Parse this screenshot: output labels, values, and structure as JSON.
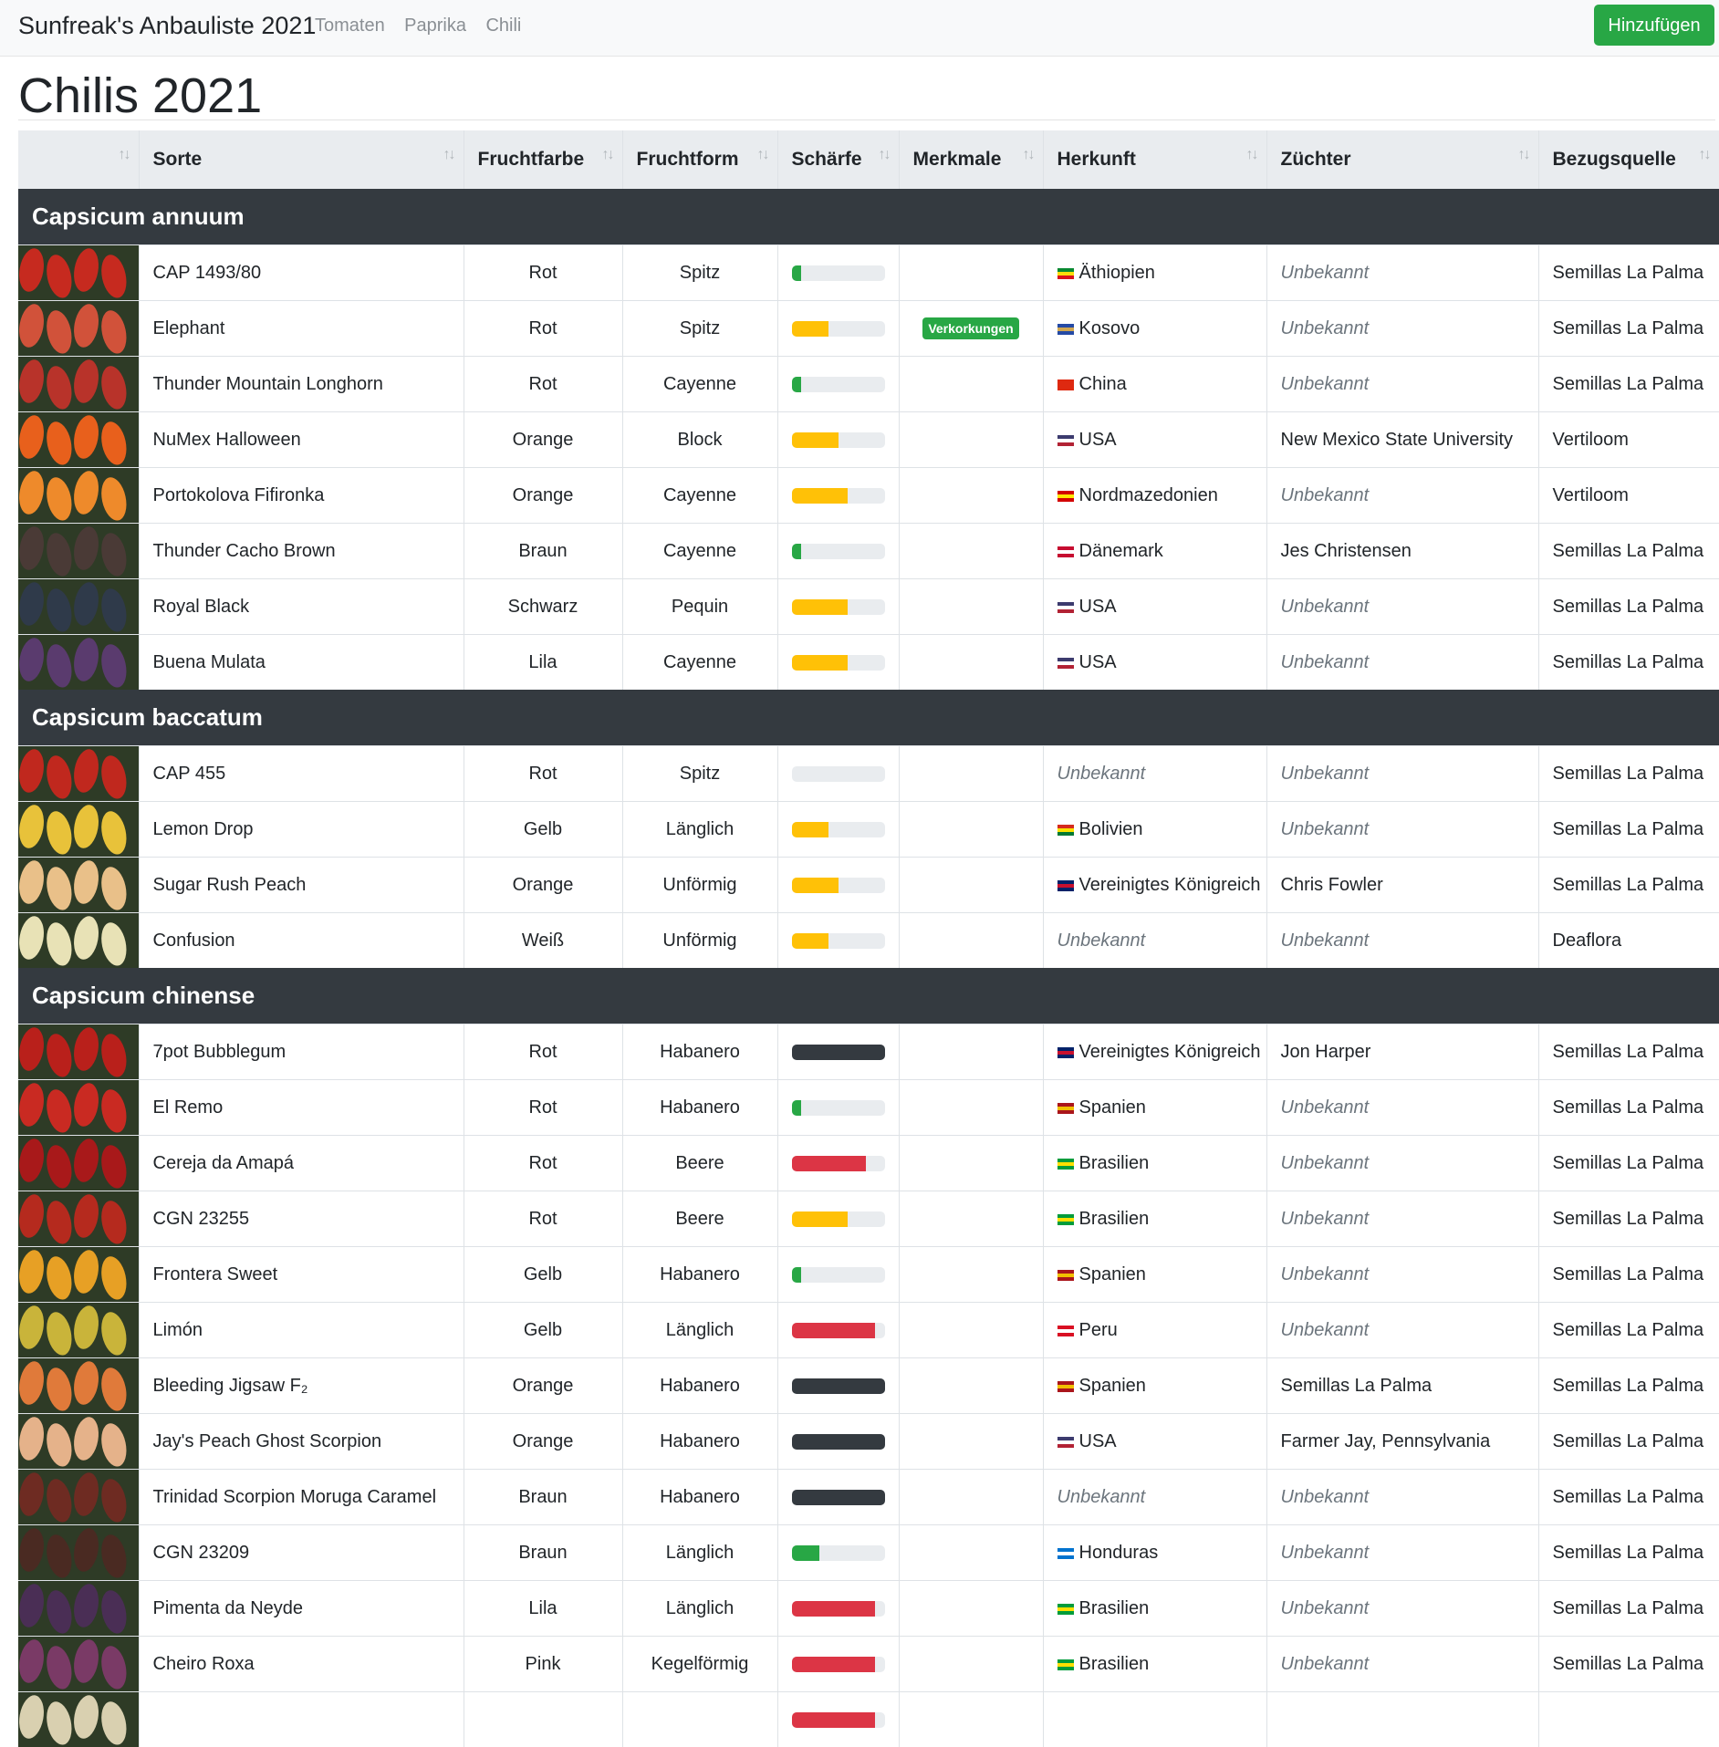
{
  "nav": {
    "brand": "Sunfreak's Anbauliste 2021",
    "links": [
      "Tomaten",
      "Paprika",
      "Chili"
    ],
    "add_label": "Hinzufügen"
  },
  "page_title": "Chilis 2021",
  "columns": [
    "Sorte",
    "Fruchtfarbe",
    "Fruchtform",
    "Schärfe",
    "Merkmale",
    "Herkunft",
    "Züchter",
    "Bezugsquelle"
  ],
  "sort_icon": "↑↓",
  "colors": {
    "mild": "#28a745",
    "medium": "#ffc107",
    "hot": "#dc3545",
    "extreme": "#343a40"
  },
  "groups": [
    {
      "name": "Capsicum annuum",
      "rows": [
        {
          "thumb": "#c62a1f",
          "name": "CAP 1493/80",
          "color": "Rot",
          "shape": "Spitz",
          "heat": 0.1,
          "heat_color": "#28a745",
          "feature": "",
          "origin": "Äthiopien",
          "origin_unknown": false,
          "flag": [
            "#078930",
            "#fcdd09",
            "#da121a"
          ],
          "breeder": "Unbekannt",
          "breeder_unknown": true,
          "source": "Semillas La Palma"
        },
        {
          "thumb": "#d1523a",
          "name": "Elephant",
          "color": "Rot",
          "shape": "Spitz",
          "heat": 0.4,
          "heat_color": "#ffc107",
          "feature": "Verkorkungen",
          "origin": "Kosovo",
          "origin_unknown": false,
          "flag": [
            "#244aa5",
            "#d0a650",
            "#244aa5"
          ],
          "breeder": "Unbekannt",
          "breeder_unknown": true,
          "source": "Semillas La Palma"
        },
        {
          "thumb": "#b8332a",
          "name": "Thunder Mountain Longhorn",
          "color": "Rot",
          "shape": "Cayenne",
          "heat": 0.1,
          "heat_color": "#28a745",
          "feature": "",
          "origin": "China",
          "origin_unknown": false,
          "flag": [
            "#de2910",
            "#de2910",
            "#de2910"
          ],
          "breeder": "Unbekannt",
          "breeder_unknown": true,
          "source": "Semillas La Palma"
        },
        {
          "thumb": "#e8601c",
          "name": "NuMex Halloween",
          "color": "Orange",
          "shape": "Block",
          "heat": 0.5,
          "heat_color": "#ffc107",
          "feature": "",
          "origin": "USA",
          "origin_unknown": false,
          "flag": [
            "#3c3b6e",
            "#ffffff",
            "#b22234"
          ],
          "breeder": "New Mexico State University",
          "breeder_unknown": false,
          "source": "Vertiloom"
        },
        {
          "thumb": "#ee8a2b",
          "name": "Portokolova Fifironka",
          "color": "Orange",
          "shape": "Cayenne",
          "heat": 0.6,
          "heat_color": "#ffc107",
          "feature": "",
          "origin": "Nordmazedonien",
          "origin_unknown": false,
          "flag": [
            "#d20000",
            "#ffe600",
            "#d20000"
          ],
          "breeder": "Unbekannt",
          "breeder_unknown": true,
          "source": "Vertiloom"
        },
        {
          "thumb": "#4a3a36",
          "name": "Thunder Cacho Brown",
          "color": "Braun",
          "shape": "Cayenne",
          "heat": 0.1,
          "heat_color": "#28a745",
          "feature": "",
          "origin": "Dänemark",
          "origin_unknown": false,
          "flag": [
            "#c60c30",
            "#ffffff",
            "#c60c30"
          ],
          "breeder": "Jes Christensen",
          "breeder_unknown": false,
          "source": "Semillas La Palma"
        },
        {
          "thumb": "#2f3a4a",
          "name": "Royal Black",
          "color": "Schwarz",
          "shape": "Pequin",
          "heat": 0.6,
          "heat_color": "#ffc107",
          "feature": "",
          "origin": "USA",
          "origin_unknown": false,
          "flag": [
            "#3c3b6e",
            "#ffffff",
            "#b22234"
          ],
          "breeder": "Unbekannt",
          "breeder_unknown": true,
          "source": "Semillas La Palma"
        },
        {
          "thumb": "#5a3b6e",
          "name": "Buena Mulata",
          "color": "Lila",
          "shape": "Cayenne",
          "heat": 0.6,
          "heat_color": "#ffc107",
          "feature": "",
          "origin": "USA",
          "origin_unknown": false,
          "flag": [
            "#3c3b6e",
            "#ffffff",
            "#b22234"
          ],
          "breeder": "Unbekannt",
          "breeder_unknown": true,
          "source": "Semillas La Palma"
        }
      ]
    },
    {
      "name": "Capsicum baccatum",
      "rows": [
        {
          "thumb": "#c0281e",
          "name": "CAP 455",
          "color": "Rot",
          "shape": "Spitz",
          "heat": 0,
          "heat_color": "#ffc107",
          "feature": "",
          "origin": "Unbekannt",
          "origin_unknown": true,
          "flag": null,
          "breeder": "Unbekannt",
          "breeder_unknown": true,
          "source": "Semillas La Palma"
        },
        {
          "thumb": "#e8c23a",
          "name": "Lemon Drop",
          "color": "Gelb",
          "shape": "Länglich",
          "heat": 0.4,
          "heat_color": "#ffc107",
          "feature": "",
          "origin": "Bolivien",
          "origin_unknown": false,
          "flag": [
            "#d52b1e",
            "#f9e300",
            "#007934"
          ],
          "breeder": "Unbekannt",
          "breeder_unknown": true,
          "source": "Semillas La Palma"
        },
        {
          "thumb": "#e9c089",
          "name": "Sugar Rush Peach",
          "color": "Orange",
          "shape": "Unförmig",
          "heat": 0.5,
          "heat_color": "#ffc107",
          "feature": "",
          "origin": "Vereinigtes Königreich",
          "origin_unknown": false,
          "flag": [
            "#012169",
            "#c8102e",
            "#012169"
          ],
          "breeder": "Chris Fowler",
          "breeder_unknown": false,
          "source": "Semillas La Palma"
        },
        {
          "thumb": "#e8e2b6",
          "name": "Confusion",
          "color": "Weiß",
          "shape": "Unförmig",
          "heat": 0.4,
          "heat_color": "#ffc107",
          "feature": "",
          "origin": "Unbekannt",
          "origin_unknown": true,
          "flag": null,
          "breeder": "Unbekannt",
          "breeder_unknown": true,
          "source": "Deaflora"
        }
      ]
    },
    {
      "name": "Capsicum chinense",
      "rows": [
        {
          "thumb": "#b9201b",
          "name": "7pot Bubblegum",
          "color": "Rot",
          "shape": "Habanero",
          "heat": 1.0,
          "heat_color": "#343a40",
          "feature": "",
          "origin": "Vereinigtes Königreich",
          "origin_unknown": false,
          "flag": [
            "#012169",
            "#c8102e",
            "#012169"
          ],
          "breeder": "Jon Harper",
          "breeder_unknown": false,
          "source": "Semillas La Palma"
        },
        {
          "thumb": "#c92a22",
          "name": "El Remo",
          "color": "Rot",
          "shape": "Habanero",
          "heat": 0.1,
          "heat_color": "#28a745",
          "feature": "",
          "origin": "Spanien",
          "origin_unknown": false,
          "flag": [
            "#aa151b",
            "#f1bf00",
            "#aa151b"
          ],
          "breeder": "Unbekannt",
          "breeder_unknown": true,
          "source": "Semillas La Palma"
        },
        {
          "thumb": "#a8191a",
          "name": "Cereja da Amapá",
          "color": "Rot",
          "shape": "Beere",
          "heat": 0.8,
          "heat_color": "#dc3545",
          "feature": "",
          "origin": "Brasilien",
          "origin_unknown": false,
          "flag": [
            "#009c3b",
            "#ffdf00",
            "#009c3b"
          ],
          "breeder": "Unbekannt",
          "breeder_unknown": true,
          "source": "Semillas La Palma"
        },
        {
          "thumb": "#b52a1e",
          "name": "CGN 23255",
          "color": "Rot",
          "shape": "Beere",
          "heat": 0.6,
          "heat_color": "#ffc107",
          "feature": "",
          "origin": "Brasilien",
          "origin_unknown": false,
          "flag": [
            "#009c3b",
            "#ffdf00",
            "#009c3b"
          ],
          "breeder": "Unbekannt",
          "breeder_unknown": true,
          "source": "Semillas La Palma"
        },
        {
          "thumb": "#e7a025",
          "name": "Frontera Sweet",
          "color": "Gelb",
          "shape": "Habanero",
          "heat": 0.1,
          "heat_color": "#28a745",
          "feature": "",
          "origin": "Spanien",
          "origin_unknown": false,
          "flag": [
            "#aa151b",
            "#f1bf00",
            "#aa151b"
          ],
          "breeder": "Unbekannt",
          "breeder_unknown": true,
          "source": "Semillas La Palma"
        },
        {
          "thumb": "#c9b43a",
          "name": "Limón",
          "color": "Gelb",
          "shape": "Länglich",
          "heat": 0.9,
          "heat_color": "#dc3545",
          "feature": "",
          "origin": "Peru",
          "origin_unknown": false,
          "flag": [
            "#d91023",
            "#ffffff",
            "#d91023"
          ],
          "breeder": "Unbekannt",
          "breeder_unknown": true,
          "source": "Semillas La Palma"
        },
        {
          "thumb": "#e07a3a",
          "name": "Bleeding Jigsaw F₂",
          "color": "Orange",
          "shape": "Habanero",
          "heat": 1.0,
          "heat_color": "#343a40",
          "feature": "",
          "origin": "Spanien",
          "origin_unknown": false,
          "flag": [
            "#aa151b",
            "#f1bf00",
            "#aa151b"
          ],
          "breeder": "Semillas La Palma",
          "breeder_unknown": false,
          "source": "Semillas La Palma"
        },
        {
          "thumb": "#e5b28a",
          "name": "Jay's Peach Ghost Scorpion",
          "color": "Orange",
          "shape": "Habanero",
          "heat": 1.0,
          "heat_color": "#343a40",
          "feature": "",
          "origin": "USA",
          "origin_unknown": false,
          "flag": [
            "#3c3b6e",
            "#ffffff",
            "#b22234"
          ],
          "breeder": "Farmer Jay, Pennsylvania",
          "breeder_unknown": false,
          "source": "Semillas La Palma"
        },
        {
          "thumb": "#6e2b22",
          "name": "Trinidad Scorpion Moruga Caramel",
          "color": "Braun",
          "shape": "Habanero",
          "heat": 1.0,
          "heat_color": "#343a40",
          "feature": "",
          "origin": "Unbekannt",
          "origin_unknown": true,
          "flag": null,
          "breeder": "Unbekannt",
          "breeder_unknown": true,
          "source": "Semillas La Palma"
        },
        {
          "thumb": "#4a2a22",
          "name": "CGN 23209",
          "color": "Braun",
          "shape": "Länglich",
          "heat": 0.3,
          "heat_color": "#28a745",
          "feature": "",
          "origin": "Honduras",
          "origin_unknown": false,
          "flag": [
            "#0073cf",
            "#ffffff",
            "#0073cf"
          ],
          "breeder": "Unbekannt",
          "breeder_unknown": true,
          "source": "Semillas La Palma"
        },
        {
          "thumb": "#4a2e55",
          "name": "Pimenta da Neyde",
          "color": "Lila",
          "shape": "Länglich",
          "heat": 0.9,
          "heat_color": "#dc3545",
          "feature": "",
          "origin": "Brasilien",
          "origin_unknown": false,
          "flag": [
            "#009c3b",
            "#ffdf00",
            "#009c3b"
          ],
          "breeder": "Unbekannt",
          "breeder_unknown": true,
          "source": "Semillas La Palma"
        },
        {
          "thumb": "#7a3a66",
          "name": "Cheiro Roxa",
          "color": "Pink",
          "shape": "Kegelförmig",
          "heat": 0.9,
          "heat_color": "#dc3545",
          "feature": "",
          "origin": "Brasilien",
          "origin_unknown": false,
          "flag": [
            "#009c3b",
            "#ffdf00",
            "#009c3b"
          ],
          "breeder": "Unbekannt",
          "breeder_unknown": true,
          "source": "Semillas La Palma"
        },
        {
          "thumb": "#d9d0b0",
          "name": "",
          "color": "",
          "shape": "",
          "heat": 0.9,
          "heat_color": "#dc3545",
          "feature": "",
          "origin": "",
          "origin_unknown": false,
          "flag": null,
          "breeder": "",
          "breeder_unknown": false,
          "source": ""
        }
      ]
    }
  ]
}
